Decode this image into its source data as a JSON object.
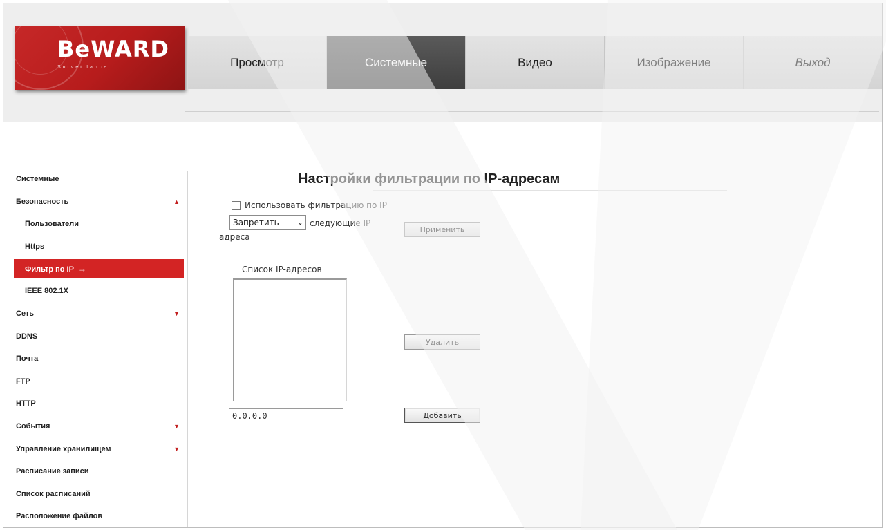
{
  "logo": {
    "text": "BeWARD",
    "subtext": "Surveillance"
  },
  "nav": {
    "tabs": [
      {
        "label": "Просмотр"
      },
      {
        "label": "Системные"
      },
      {
        "label": "Видео"
      },
      {
        "label": "Изображение"
      },
      {
        "label": "Выход"
      }
    ],
    "active": "Системные"
  },
  "sidebar": {
    "items": [
      {
        "label": "Системные"
      },
      {
        "label": "Безопасность",
        "arrow": "▲"
      },
      {
        "label": "Пользователи"
      },
      {
        "label": "Https"
      },
      {
        "label": "Фильтр по IP",
        "pointer": "→"
      },
      {
        "label": "IEEE 802.1X"
      },
      {
        "label": "Сеть",
        "arrow": "▼"
      },
      {
        "label": "DDNS"
      },
      {
        "label": "Почта"
      },
      {
        "label": "FTP"
      },
      {
        "label": "HTTP"
      },
      {
        "label": "События",
        "arrow": "▼"
      },
      {
        "label": "Управление хранилищем",
        "arrow": "▼"
      },
      {
        "label": "Расписание записи"
      },
      {
        "label": "Список расписаний"
      },
      {
        "label": "Расположение файлов"
      }
    ]
  },
  "main": {
    "title": "Настройки фильтрации по IP-адресам",
    "use_filter_label": "Использовать фильтрацию по IP",
    "mode_select": {
      "value": "Запретить",
      "caret": "⌄"
    },
    "following_label": "следующие IP",
    "addresses_label": "адреса",
    "apply_button": "Применить",
    "list_label": "Список IP-адресов",
    "delete_button": "Удалить",
    "ip_input_value": "0.0.0.0",
    "add_button": "Добавить"
  }
}
